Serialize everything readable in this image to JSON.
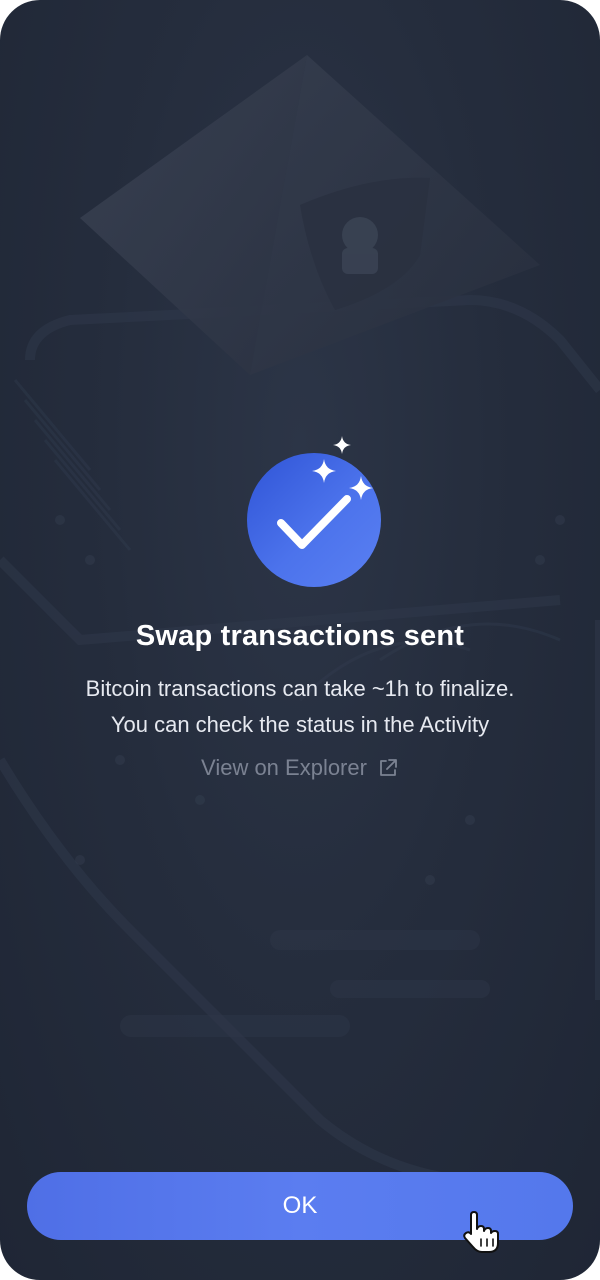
{
  "dialog": {
    "title": "Swap transactions sent",
    "description": "Bitcoin transactions can take ~1h to finalize. You can check the status in the Activity",
    "explorer_link": "View on Explorer",
    "ok_label": "OK"
  },
  "icons": {
    "status": "checkmark-icon",
    "sparkles": "sparkle-icon",
    "link": "external-link-icon",
    "pointer": "hand-pointer-icon",
    "background": "shield-pyramid-illustration"
  },
  "colors": {
    "background": "#252d3d",
    "accent": "#5b7df0",
    "check_circle": "#4c73ec",
    "title": "#ffffff",
    "description": "#e6e9f0",
    "link": "#7b8292"
  }
}
